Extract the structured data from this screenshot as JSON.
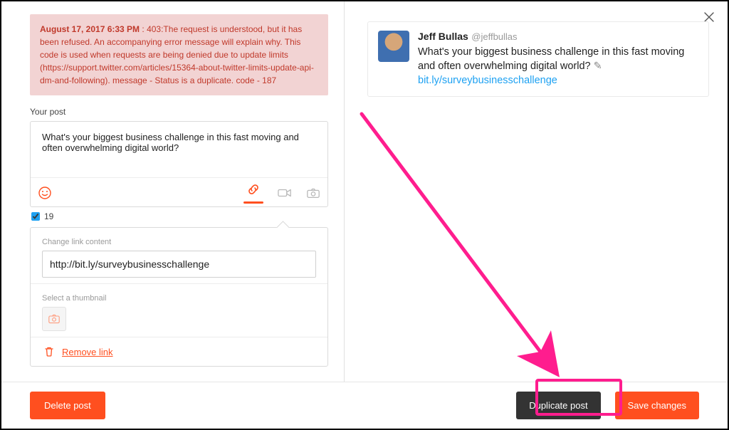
{
  "error": {
    "timestamp": "August 17, 2017 6:33 PM",
    "sep": " : ",
    "message": "403:The request is understood, but it has been refused. An accompanying error message will explain why. This code is used when requests are being denied due to update limits (https://support.twitter.com/articles/15364-about-twitter-limits-update-api-dm-and-following). message - Status is a duplicate. code - 187"
  },
  "labels": {
    "your_post": "Your post",
    "change_link": "Change link content",
    "select_thumb": "Select a thumbnail",
    "remove_link": "Remove link"
  },
  "post": {
    "text": "What's your biggest business challenge in this fast moving and often overwhelming digital world?"
  },
  "counter": "19",
  "link": {
    "url": "http://bit.ly/surveybusinesschallenge",
    "short": "bit.ly/surveybusinesschallenge"
  },
  "preview": {
    "name": "Jeff Bullas",
    "handle": "@jeffbullas",
    "body_before": "What's your biggest business challenge in this fast moving and often overwhelming digital world? ",
    "pencil": "✎ "
  },
  "buttons": {
    "delete": "Delete post",
    "duplicate": "Duplicate post",
    "save": "Save changes"
  }
}
